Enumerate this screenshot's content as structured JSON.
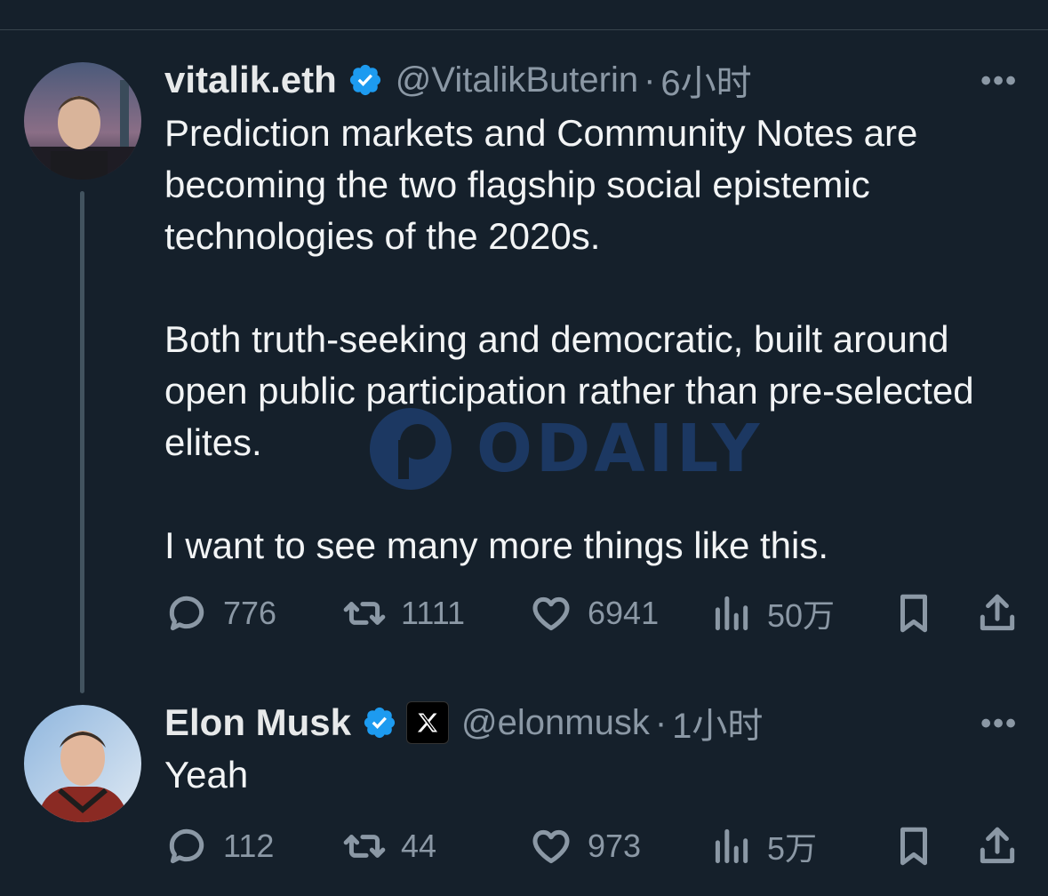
{
  "tweets": [
    {
      "display_name": "vitalik.eth",
      "handle": "@VitalikButerin",
      "separator": "·",
      "time": "6小时",
      "more": "•••",
      "paragraphs": [
        "Prediction markets and Community Notes are becoming the two flagship social epistemic technologies of the 2020s.",
        "Both truth-seeking and democratic, built around open public participation rather than pre-selected elites.",
        "I want to see many more things like this."
      ],
      "replies": "776",
      "retweets": "1111",
      "likes": "6941",
      "views": "50万"
    },
    {
      "display_name": "Elon Musk",
      "handle": "@elonmusk",
      "separator": "·",
      "time": "1小时",
      "more": "•••",
      "paragraphs": [
        "Yeah"
      ],
      "replies": "112",
      "retweets": "44",
      "likes": "973",
      "views": "5万"
    }
  ],
  "watermark": {
    "text": "ODAILY"
  },
  "colors": {
    "background": "#15202b",
    "verified": "#1d9bf0",
    "muted": "#8b98a5"
  }
}
